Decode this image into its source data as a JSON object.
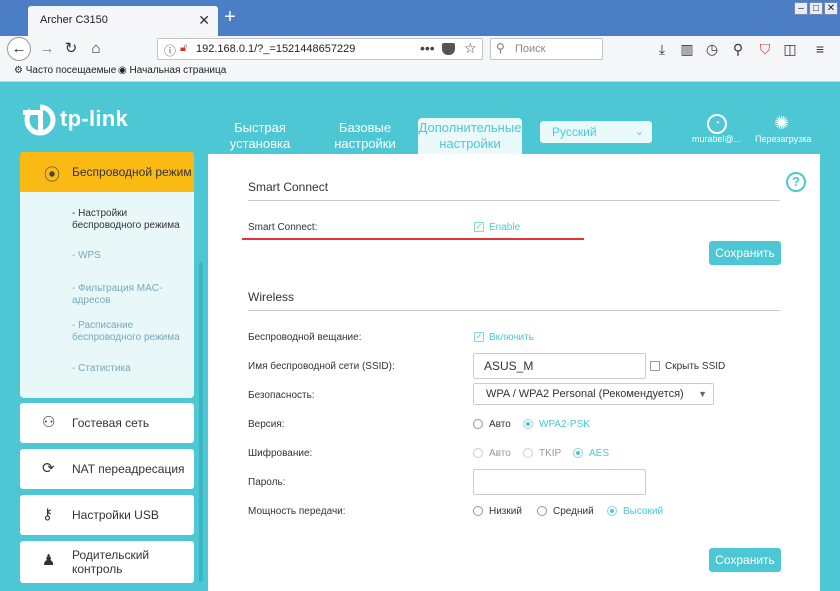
{
  "browser": {
    "tab_title": "Archer C3150",
    "url": "192.168.0.1/?_=1521448657229",
    "search_placeholder": "Поиск",
    "bookmarks": [
      "Часто посещаемые",
      "Начальная страница"
    ]
  },
  "header": {
    "logo": "tp-link",
    "tabs": [
      {
        "label": "Быстрая установка",
        "active": false
      },
      {
        "label": "Базовые настройки",
        "active": false
      },
      {
        "label": "Дополнительные настройки",
        "active": true
      }
    ],
    "language": "Русский",
    "user_label": "murabel@...",
    "reboot_label": "Перезагрузка"
  },
  "sidebar": {
    "active_item": "Беспроводной режим",
    "sub_items": [
      {
        "label": "- Настройки беспроводного режима",
        "active": true
      },
      {
        "label": "- WPS",
        "active": false
      },
      {
        "label": "- Фильтрация MAC-адресов",
        "active": false
      },
      {
        "label": "- Расписание беспроводного режима",
        "active": false
      },
      {
        "label": "- Статистика",
        "active": false
      }
    ],
    "items": [
      {
        "label": "Гостевая сеть"
      },
      {
        "label": "NAT переадресация"
      },
      {
        "label": "Настройки USB"
      },
      {
        "label": "Родительский контроль"
      }
    ]
  },
  "smart_connect": {
    "title": "Smart Connect",
    "label": "Smart Connect:",
    "checkbox_label": "Enable",
    "checked": true,
    "save_label": "Сохранить"
  },
  "wireless": {
    "title": "Wireless",
    "broadcast_label": "Беспроводной вещание:",
    "broadcast_checkbox": "Включить",
    "ssid_label": "Имя беспроводной сети (SSID):",
    "ssid_value": "ASUS_M",
    "hide_ssid_label": "Скрыть SSID",
    "security_label": "Безопасность:",
    "security_value": "WPA / WPA2 Personal (Рекомендуется)",
    "version_label": "Версия:",
    "version_options": [
      "Авто",
      "WPA2-PSK"
    ],
    "version_selected": "WPA2-PSK",
    "encryption_label": "Шифрование:",
    "encryption_options": [
      "Авто",
      "TKIP",
      "AES"
    ],
    "encryption_selected": "AES",
    "password_label": "Пароль:",
    "password_value": "",
    "power_label": "Мощность передачи:",
    "power_options": [
      "Низкий",
      "Средний",
      "Высокий"
    ],
    "power_selected": "Высокий",
    "save_label": "Сохранить"
  },
  "colors": {
    "brand": "#4dc7d4",
    "active_menu": "#fbb914",
    "highlight_line": "#e8303a"
  }
}
